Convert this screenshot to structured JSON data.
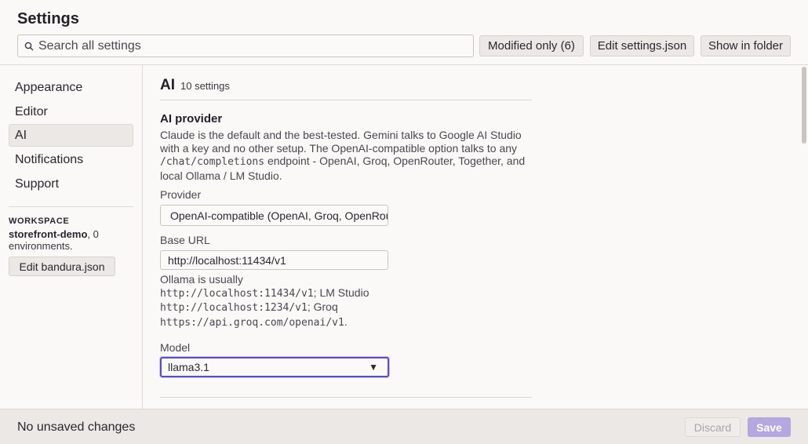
{
  "header": {
    "title": "Settings",
    "search_placeholder": "Search all settings",
    "modified_only": "Modified only (6)",
    "edit_settings_json": "Edit settings.json",
    "show_in_folder": "Show in folder"
  },
  "sidebar": {
    "items": [
      {
        "label": "Appearance"
      },
      {
        "label": "Editor"
      },
      {
        "label": "AI"
      },
      {
        "label": "Notifications"
      },
      {
        "label": "Support"
      }
    ],
    "active": "AI",
    "workspace_label": "WORKSPACE",
    "workspace_name": "storefront-demo",
    "workspace_envs": ", 0 environments.",
    "edit_workspace_button": "Edit bandura.json"
  },
  "main": {
    "section_title": "AI",
    "section_count": "10 settings",
    "setting_title": "AI provider",
    "desc_1": "Claude is the default and the best-tested. Gemini talks to Google AI Studio with a key and no other setup. The OpenAI-compatible option talks to any ",
    "desc_code": "/chat/completions",
    "desc_2": " endpoint - OpenAI, Groq, OpenRouter, Together, and local Ollama / LM Studio.",
    "provider_label": "Provider",
    "provider_value": "OpenAI-compatible (OpenAI, Groq, OpenRouter, Together, Ollama, LM Studio)",
    "base_url_label": "Base URL",
    "base_url_value": "http://localhost:11434/v1",
    "help_1": "Ollama is usually ",
    "help_code_1": "http://localhost:11434/v1",
    "help_2": "; LM Studio ",
    "help_code_2": "http://localhost:1234/v1",
    "help_3": "; Groq ",
    "help_code_3": "https://api.groq.com/openai/v1",
    "help_4": ".",
    "model_label": "Model",
    "model_value": "llama3.1"
  },
  "footer": {
    "status": "No unsaved changes",
    "discard": "Discard",
    "save": "Save"
  },
  "colors": {
    "accent": "#5b4bc4",
    "save_disabled": "#b3a8e0"
  }
}
